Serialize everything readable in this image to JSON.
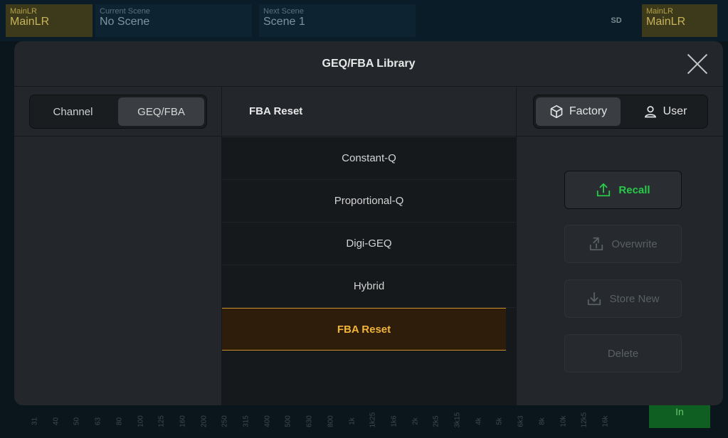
{
  "background": {
    "main_left": {
      "small": "MainLR",
      "big": "MainLR"
    },
    "current_scene": {
      "small": "Current Scene",
      "big": "No Scene"
    },
    "next_scene": {
      "small": "Next Scene",
      "big": "Scene 1"
    },
    "sd_label": "SD",
    "main_right": {
      "small": "MainLR",
      "big": "MainLR"
    },
    "freq_labels": [
      "31",
      "40",
      "50",
      "63",
      "80",
      "100",
      "125",
      "160",
      "200",
      "250",
      "315",
      "400",
      "500",
      "630",
      "800",
      "1k",
      "1k25",
      "1k6",
      "2k",
      "2k5",
      "3k15",
      "4k",
      "5k",
      "6k3",
      "8k",
      "10k",
      "12k5",
      "16k"
    ],
    "in_button": "In"
  },
  "modal": {
    "title": "GEQ/FBA Library",
    "left_tabs": [
      {
        "label": "Channel",
        "active": false
      },
      {
        "label": "GEQ/FBA",
        "active": true
      }
    ],
    "current_preset": "FBA Reset",
    "library_tabs": [
      {
        "label": "Factory",
        "icon": "cube-icon",
        "active": true
      },
      {
        "label": "User",
        "icon": "user-icon",
        "active": false
      }
    ],
    "presets": [
      {
        "label": "Constant-Q",
        "selected": false
      },
      {
        "label": "Proportional-Q",
        "selected": false
      },
      {
        "label": "Digi-GEQ",
        "selected": false
      },
      {
        "label": "Hybrid",
        "selected": false
      },
      {
        "label": "FBA Reset",
        "selected": true
      }
    ],
    "actions": {
      "recall": "Recall",
      "overwrite": "Overwrite",
      "store_new": "Store New",
      "delete": "Delete"
    },
    "colors": {
      "recall_green": "#28c94a",
      "selected_amber": "#f0b43a",
      "disabled_gray": "#5a5f63"
    }
  }
}
